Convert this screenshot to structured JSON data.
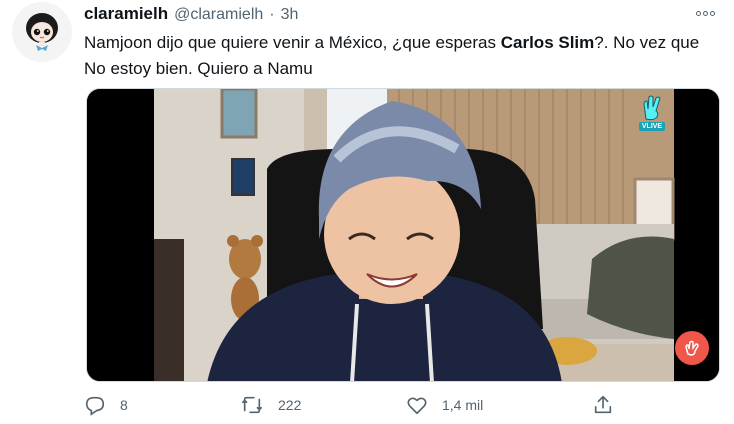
{
  "tweet": {
    "display_name": "claramielh",
    "handle": "@claramielh",
    "separator": "·",
    "time": "3h",
    "text_part1": "Namjoon dijo que quiere venir a México, ¿que esperas ",
    "text_bold": "Carlos Slim",
    "text_part2": "?. No vez que No estoy bien. Quiero a Namu"
  },
  "media": {
    "badge_label": "VLIVE"
  },
  "actions": {
    "replies": "8",
    "retweets": "222",
    "likes": "1,4 mil"
  },
  "colors": {
    "text": "#0f1419",
    "secondary": "#536471",
    "accent": "#1da1f2",
    "vlive": "#54f0f6"
  }
}
